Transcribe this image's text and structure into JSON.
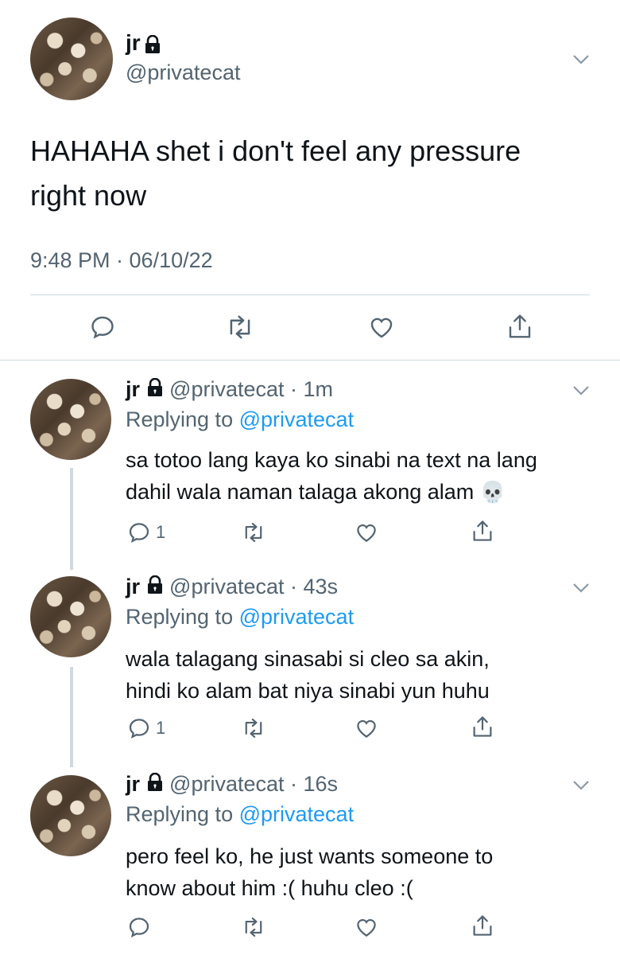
{
  "main_tweet": {
    "display_name": "jr",
    "handle": "@privatecat",
    "text_line1": "HAHAHA shet i don't feel any pressure",
    "text_line2": "right now",
    "timestamp": "9:48 PM · 06/10/22"
  },
  "replies": [
    {
      "display_name": "jr",
      "handle_time": "@privatecat · 1m",
      "replying_label": "Replying to",
      "replying_handle": "@privatecat",
      "line1": "sa totoo lang kaya ko sinabi na text na lang",
      "line2": "dahil wala naman talaga akong alam",
      "emoji": "💀",
      "reply_count": "1"
    },
    {
      "display_name": "jr",
      "handle_time": "@privatecat · 43s",
      "replying_label": "Replying to",
      "replying_handle": "@privatecat",
      "line1": "wala talagang sinasabi si cleo sa akin,",
      "line2": "hindi ko alam bat niya sinabi yun huhu",
      "reply_count": "1"
    },
    {
      "display_name": "jr",
      "handle_time": "@privatecat · 16s",
      "replying_label": "Replying to",
      "replying_handle": "@privatecat",
      "line1": "pero feel ko, he just wants someone to",
      "line2": "know about him :( huhu cleo :(",
      "reply_count": ""
    }
  ],
  "colors": {
    "text": "#0f1419",
    "muted": "#536471",
    "link": "#1d9bf0",
    "divider": "#cfd9de"
  },
  "icons": [
    "lock-icon",
    "chevron-down-icon",
    "reply-icon",
    "retweet-icon",
    "like-icon",
    "share-icon",
    "skull-emoji"
  ]
}
